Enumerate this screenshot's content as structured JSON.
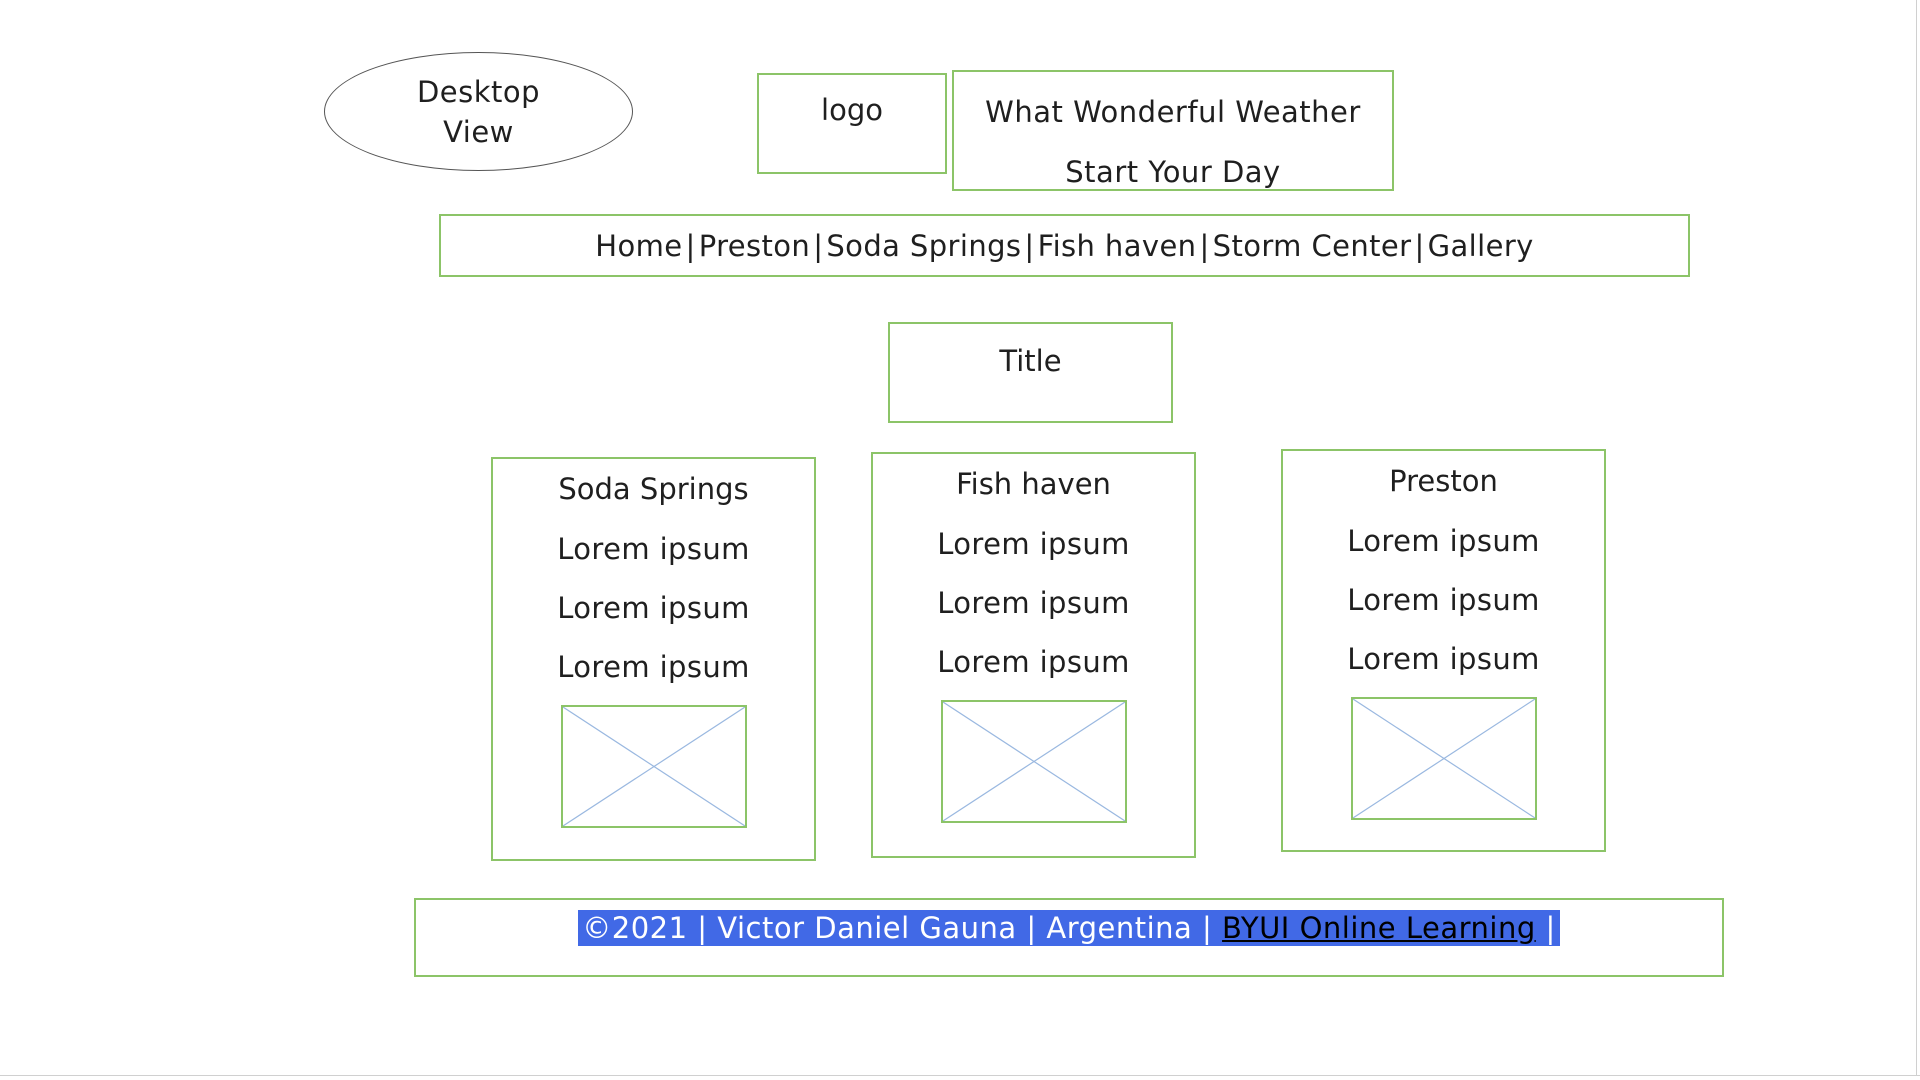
{
  "desktop_view": {
    "line1": "Desktop",
    "line2": "View"
  },
  "logo": "logo",
  "tagline": {
    "line1": "What Wonderful Weather",
    "line2": "Start Your Day"
  },
  "nav": {
    "items": [
      "Home",
      "Preston",
      "Soda Springs",
      "Fish haven",
      "Storm Center",
      "Gallery"
    ],
    "separator": "|"
  },
  "title": "Title",
  "cards": [
    {
      "title": "Soda Springs",
      "lines": [
        "Lorem ipsum",
        "Lorem ipsum",
        "Lorem ipsum"
      ]
    },
    {
      "title": "Fish haven",
      "lines": [
        "Lorem ipsum",
        "Lorem ipsum",
        "Lorem ipsum"
      ]
    },
    {
      "title": "Preston",
      "lines": [
        "Lorem ipsum",
        "Lorem ipsum",
        "Lorem ipsum"
      ]
    }
  ],
  "footer": {
    "text": "©2021 | Victor Daniel Gauna | Argentina | ",
    "link": "BYUI Online Learning",
    "tail": " |"
  },
  "colors": {
    "box_border": "#8cc468",
    "highlight": "#4169e6",
    "placeholder_x": "#9ab8e0"
  }
}
